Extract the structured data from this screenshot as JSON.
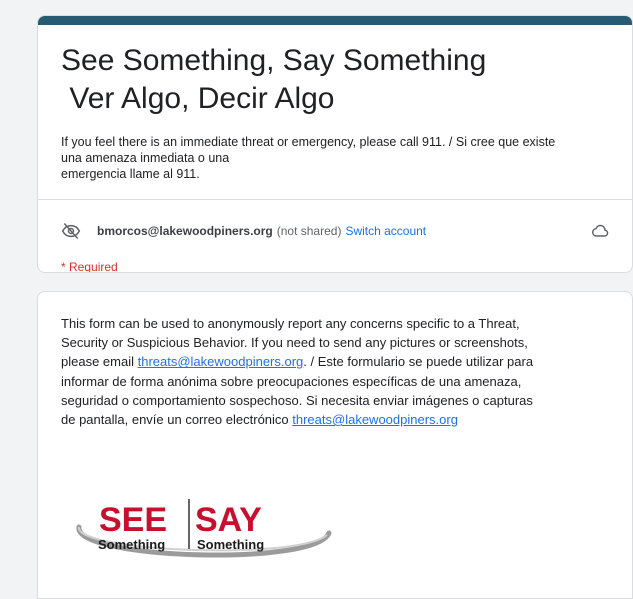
{
  "form": {
    "title_line1": "See Something, Say Something",
    "title_line2": " Ver Algo, Decir Algo",
    "description_lines": [
      "If you feel there is an immediate threat or emergency, please call 911. / Si cree que existe",
      "una amenaza inmediata o una",
      "emergencia llame al 911."
    ],
    "account_email": "bmorcos@lakewoodpiners.org",
    "not_shared": "(not shared)",
    "switch_account": "Switch account",
    "required": "* Required"
  },
  "info": {
    "line1": "This form can be used to anonymously report any concerns specific to a Threat,",
    "line2": "Security or Suspicious Behavior. If you need to send any pictures or screenshots,",
    "line3_prefix": "please email ",
    "line3_link": "threats@lakewoodpiners.org",
    "line3_suffix": ".  /  Este formulario se puede utilizar para",
    "line4": "informar de forma anónima sobre preocupaciones específicas de una amenaza,",
    "line5": "seguridad o comportamiento sospechoso. Si necesita enviar imágenes o capturas",
    "line6_prefix": "de pantalla, envíe un correo electrónico ",
    "line6_link": "threats@lakewoodpiners.org"
  },
  "logo": {
    "see": "SEE",
    "say": "SAY",
    "something_left": "Something",
    "something_right": "Something"
  },
  "colors": {
    "accent_bar": "#275a73",
    "link": "#1a73e8",
    "required": "#d93025",
    "logo_red": "#c8102e"
  },
  "icons": {
    "account_icon": "eye-off-icon",
    "cloud_icon": "cloud-save-icon"
  }
}
